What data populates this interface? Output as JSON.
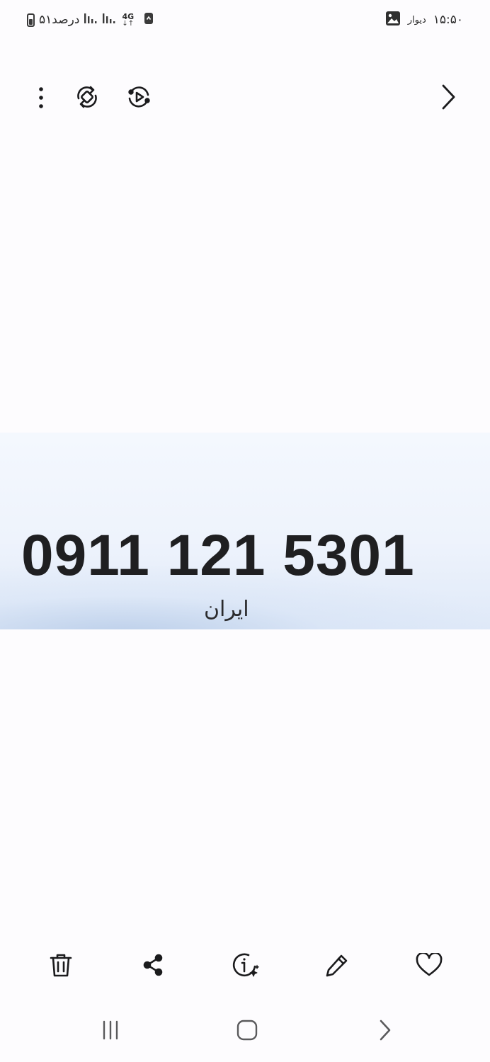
{
  "status_bar": {
    "battery_text": "۵۱درصد",
    "network_type": "4G",
    "notification_app": "دیوار",
    "time": "۱۵:۵۰"
  },
  "top_toolbar": {
    "icons": [
      "more-options-icon",
      "rotate-icon",
      "play-video-icon",
      "forward-arrow-icon"
    ]
  },
  "photo": {
    "phone_number": "0911 121 5301",
    "country": "ایران",
    "colors": {
      "band_top": "#f4f8fe",
      "band_bottom": "#dfe9f8",
      "text": "#1f1f21"
    }
  },
  "bottom_toolbar": {
    "icons": [
      "delete-icon",
      "share-icon",
      "details-icon",
      "edit-icon",
      "favorite-icon"
    ]
  },
  "nav_bar": {
    "icons": [
      "recent-apps-icon",
      "home-icon",
      "back-icon"
    ]
  }
}
